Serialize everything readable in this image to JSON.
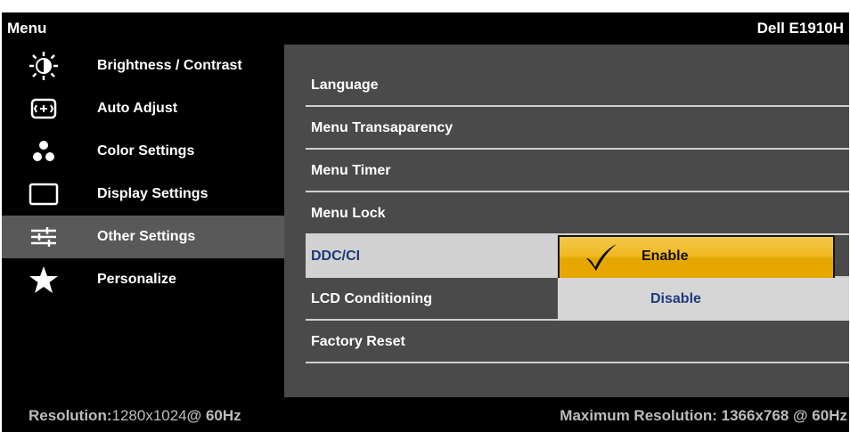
{
  "header": {
    "title": "Menu",
    "model": "Dell E1910H"
  },
  "sidebar": {
    "items": [
      {
        "label": "Brightness / Contrast",
        "icon": "brightness-icon"
      },
      {
        "label": "Auto Adjust",
        "icon": "auto-adjust-icon"
      },
      {
        "label": "Color Settings",
        "icon": "color-dots-icon"
      },
      {
        "label": "Display Settings",
        "icon": "display-rectangle-icon"
      },
      {
        "label": "Other Settings",
        "icon": "sliders-icon",
        "active": true
      },
      {
        "label": "Personalize",
        "icon": "star-icon"
      }
    ]
  },
  "panel": {
    "options": [
      {
        "label": "Language"
      },
      {
        "label": "Menu Transaparency"
      },
      {
        "label": "Menu Timer"
      },
      {
        "label": "Menu Lock"
      },
      {
        "label": "DDC/CI",
        "selected": true
      },
      {
        "label": "LCD Conditioning"
      },
      {
        "label": "Factory Reset"
      }
    ],
    "ddc_choices": {
      "enable": {
        "label": "Enable",
        "checked": true
      },
      "disable": {
        "label": "Disable"
      }
    }
  },
  "footer": {
    "resolution_label": "Resolution:",
    "resolution_value": "1280x1024",
    "resolution_rate": "@ 60Hz",
    "max_resolution": "Maximum Resolution: 1366x768 @ 60Hz"
  },
  "colors": {
    "highlight_gold": "#f0b820",
    "selected_text_blue": "#1d3a78",
    "panel_gray": "#4a4a4a",
    "active_sidebar_gray": "#595959"
  }
}
